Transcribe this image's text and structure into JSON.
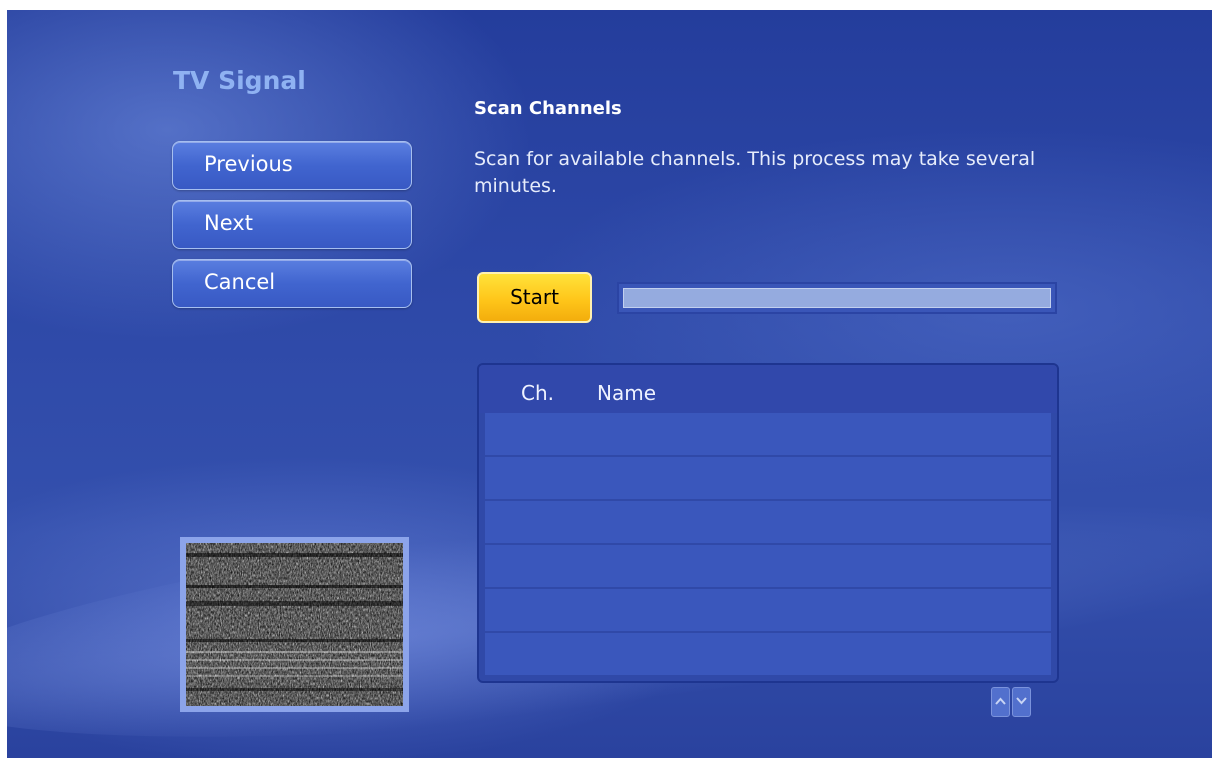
{
  "window": {
    "title": "TV Signal"
  },
  "nav": {
    "previous_label": "Previous",
    "next_label": "Next",
    "cancel_label": "Cancel"
  },
  "content": {
    "section_title": "Scan Channels",
    "description": "Scan for available channels. This process may take several minutes.",
    "start_label": "Start"
  },
  "channel_list": {
    "columns": [
      "Ch.",
      "Name"
    ],
    "rows": []
  },
  "preview": {
    "icon": "static-noise-icon"
  },
  "scroll": {
    "up_icon": "chevron-up-icon",
    "down_icon": "chevron-down-icon"
  },
  "colors": {
    "background": "#2e49a8",
    "title": "#8fb2f2",
    "start_button": "#ffc61a",
    "button_border": "#a6bff0"
  }
}
